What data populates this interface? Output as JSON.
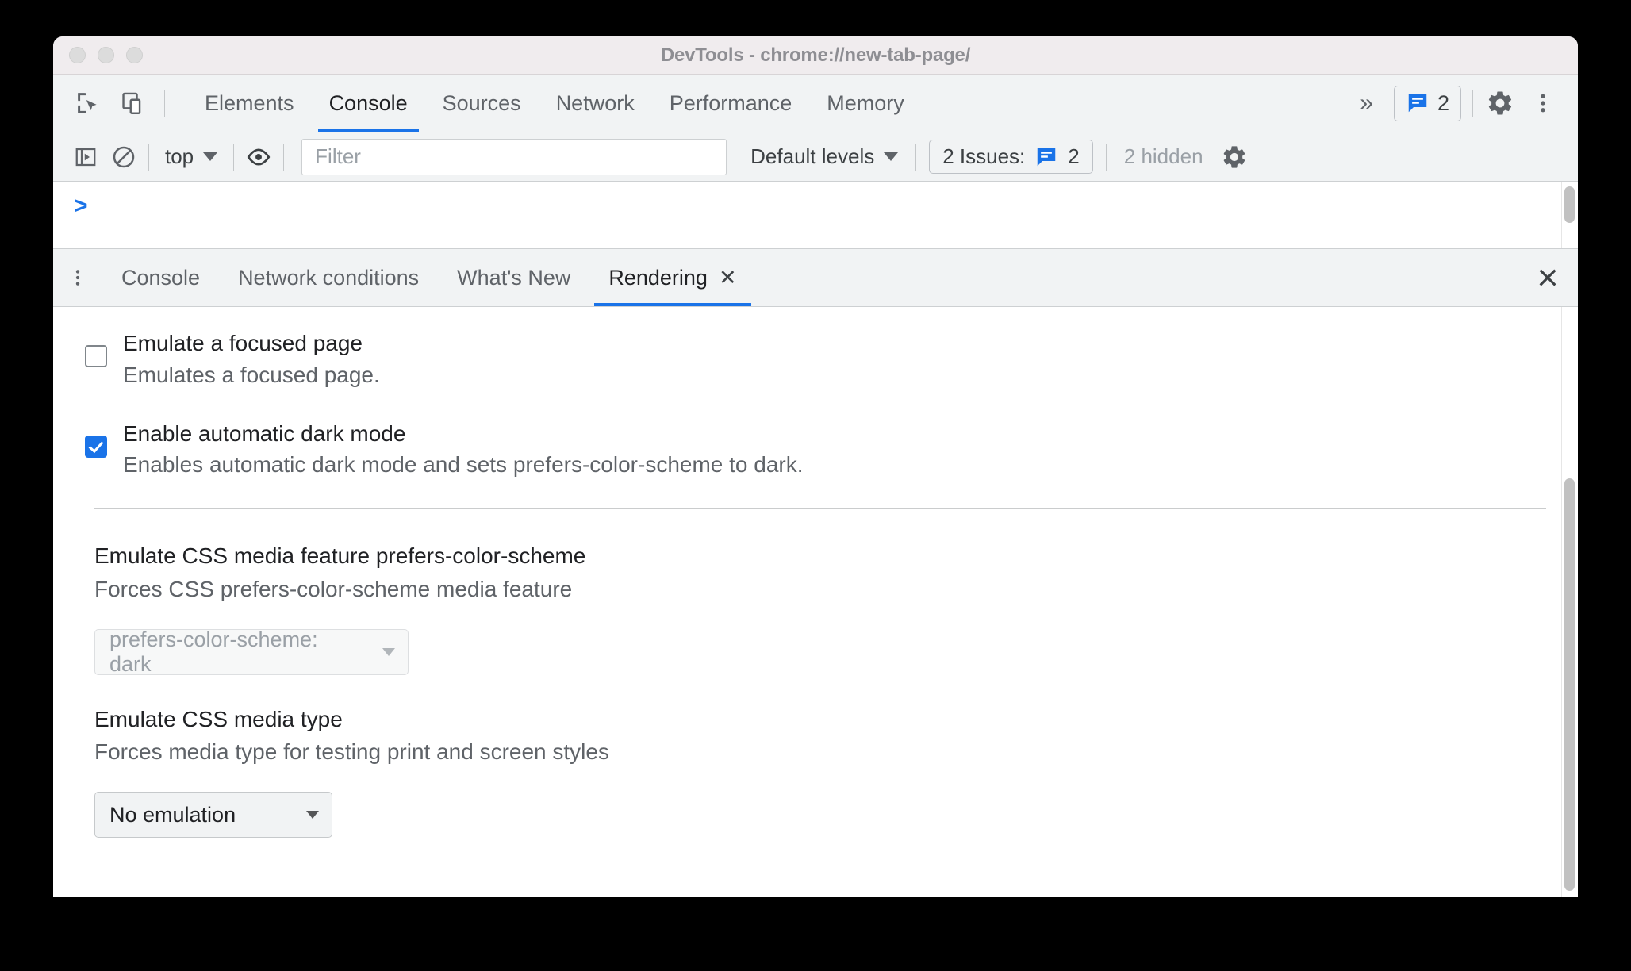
{
  "window": {
    "title": "DevTools - chrome://new-tab-page/",
    "traffic_lights": [
      "close",
      "minimize",
      "maximize"
    ]
  },
  "main_toolbar": {
    "icons": [
      {
        "name": "inspect-element-icon",
        "label": "Inspect element"
      },
      {
        "name": "device-toolbar-icon",
        "label": "Toggle device toolbar"
      }
    ],
    "tabs": [
      {
        "label": "Elements",
        "active": false
      },
      {
        "label": "Console",
        "active": true
      },
      {
        "label": "Sources",
        "active": false
      },
      {
        "label": "Network",
        "active": false
      },
      {
        "label": "Performance",
        "active": false
      },
      {
        "label": "Memory",
        "active": false
      }
    ],
    "overflow_label": "»",
    "issues_badge_count": "2",
    "settings_label": "Settings",
    "more_label": "Customize and control DevTools"
  },
  "console_toolbar": {
    "sidebar_toggle": "console-sidebar-icon",
    "clear_label": "clear-console-icon",
    "context": "top",
    "eye_label": "live-expression-icon",
    "filter_placeholder": "Filter",
    "filter_value": "",
    "levels": "Default levels",
    "issues_text": "2 Issues:",
    "issues_count": "2",
    "hidden_text": "2 hidden",
    "settings_label": "Console settings"
  },
  "console_output": {
    "prompt": ">"
  },
  "drawer": {
    "menu_label": "More tools",
    "tabs": [
      {
        "label": "Console",
        "active": false,
        "closable": false
      },
      {
        "label": "Network conditions",
        "active": false,
        "closable": false
      },
      {
        "label": "What's New",
        "active": false,
        "closable": false
      },
      {
        "label": "Rendering",
        "active": true,
        "closable": true,
        "close_glyph": "✕"
      }
    ],
    "close_glyph": "✕"
  },
  "rendering": {
    "settings": [
      {
        "title": "Emulate a focused page",
        "description": "Emulates a focused page.",
        "checked": false
      },
      {
        "title": "Enable automatic dark mode",
        "description": "Enables automatic dark mode and sets prefers-color-scheme to dark.",
        "checked": true
      }
    ],
    "media_feature": {
      "title": "Emulate CSS media feature prefers-color-scheme",
      "description": "Forces CSS prefers-color-scheme media feature",
      "select_value": "prefers-color-scheme: dark",
      "disabled": true
    },
    "media_type": {
      "title": "Emulate CSS media type",
      "description": "Forces media type for testing print and screen styles",
      "select_value": "No emulation",
      "disabled": false
    }
  },
  "colors": {
    "accent": "#1a73e8",
    "toolbar_bg": "#f1f3f4",
    "titlebar_bg": "#f0ecee",
    "text_primary": "#202124",
    "text_secondary": "#5f6368",
    "text_muted": "#9aa0a6"
  }
}
